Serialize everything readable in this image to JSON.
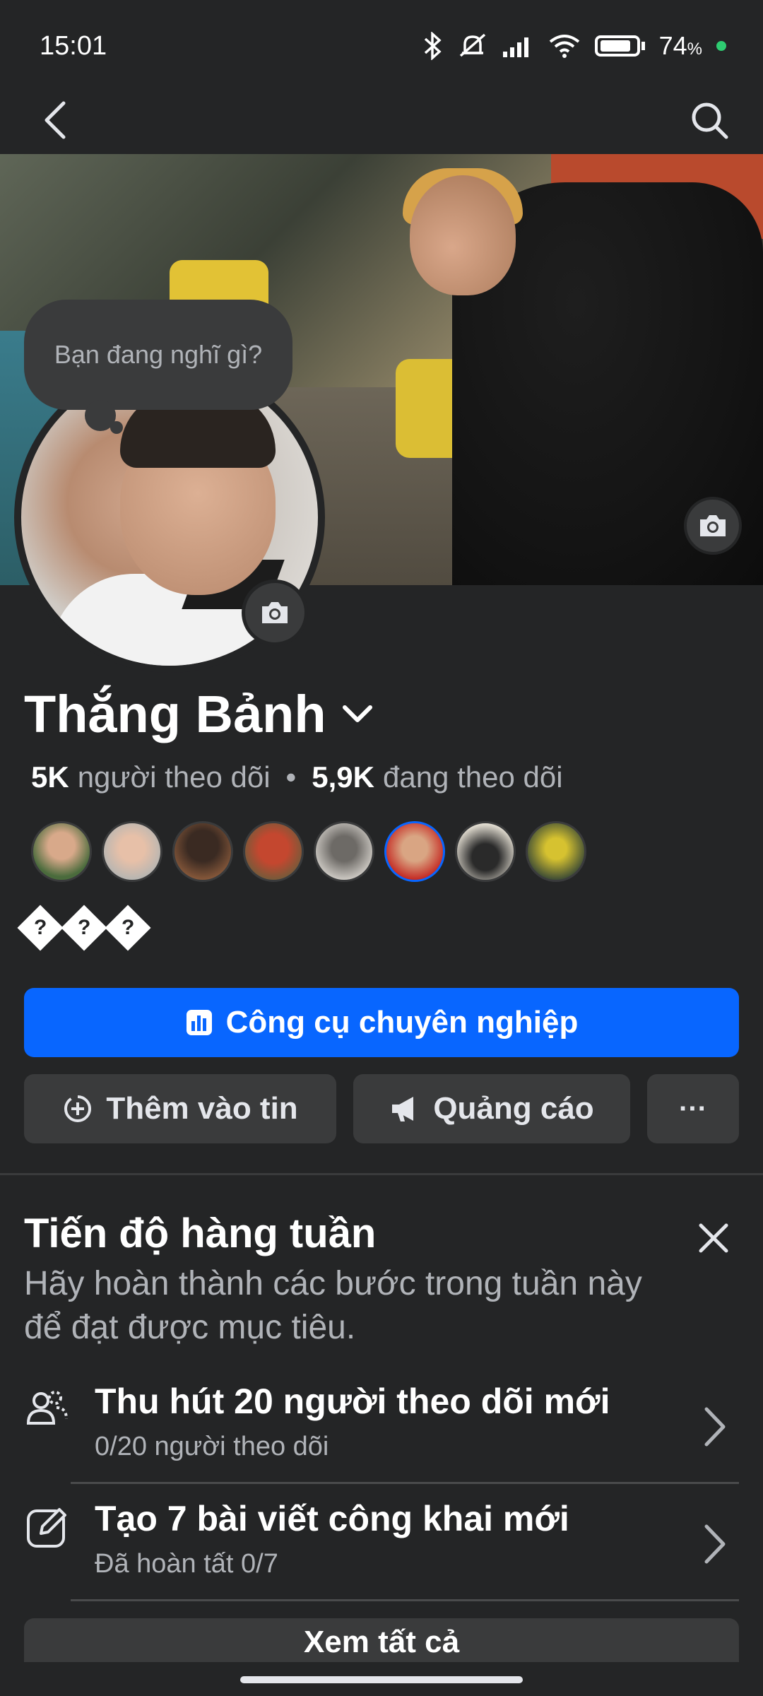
{
  "status_bar": {
    "time": "15:01",
    "battery": "74",
    "battery_unit": "%"
  },
  "icons": {
    "back": "back-arrow-icon",
    "search": "search-icon",
    "camera": "camera-icon",
    "chevron_down": "chevron-down-icon",
    "close": "close-icon"
  },
  "profile": {
    "thought_bubble": "Bạn đang nghĩ gì?",
    "name": "Thắng Bảnh",
    "followers_count": "5K",
    "followers_label": "người theo dõi",
    "separator": "•",
    "following_count": "5,9K",
    "following_label": "đang theo dõi",
    "bio_glyph": "?",
    "bio_glyph_count": 3
  },
  "actions": {
    "primary": "Công cụ chuyên nghiệp",
    "add_story": "Thêm vào tin",
    "ads": "Quảng cáo",
    "more": "···"
  },
  "weekly": {
    "title": "Tiến độ hàng tuần",
    "description": "Hãy hoàn thành các bước trong tuần này để đạt được mục tiêu.",
    "tasks": [
      {
        "title": "Thu hút 20 người theo dõi mới",
        "subtitle": "0/20 người theo dõi"
      },
      {
        "title": "Tạo 7 bài viết công khai mới",
        "subtitle": "Đã hoàn tất 0/7"
      }
    ],
    "see_all": "Xem tất cả"
  },
  "colors": {
    "background": "#242526",
    "primary_button": "#0866ff",
    "secondary_button": "#3a3b3c",
    "text_primary": "#ffffff",
    "text_secondary": "#b0b3b8"
  }
}
